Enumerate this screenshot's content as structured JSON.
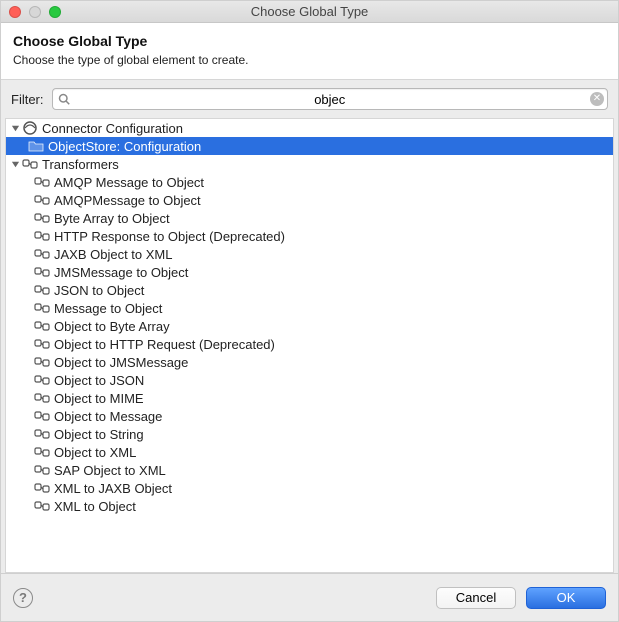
{
  "window": {
    "title": "Choose Global Type"
  },
  "header": {
    "heading": "Choose Global Type",
    "subtext": "Choose the type of global element to create."
  },
  "filter": {
    "label": "Filter:",
    "value": "objec",
    "placeholder": ""
  },
  "tree": {
    "groups": [
      {
        "name": "connector-config",
        "label": "Connector Configuration",
        "expanded": true,
        "iconKind": "connector",
        "children": [
          {
            "name": "objectstore-config",
            "label": "ObjectStore: Configuration",
            "selected": true,
            "iconKind": "folder"
          }
        ]
      },
      {
        "name": "transformers",
        "label": "Transformers",
        "expanded": true,
        "iconKind": "transformer",
        "children": [
          {
            "name": "amqp-message-to-object",
            "label": "AMQP Message to Object",
            "iconKind": "transformer"
          },
          {
            "name": "amqpmessage-to-object",
            "label": "AMQPMessage to Object",
            "iconKind": "transformer"
          },
          {
            "name": "byte-array-to-object",
            "label": "Byte Array to Object",
            "iconKind": "transformer"
          },
          {
            "name": "http-response-to-object",
            "label": "HTTP Response to Object (Deprecated)",
            "iconKind": "transformer"
          },
          {
            "name": "jaxb-object-to-xml",
            "label": "JAXB Object to XML",
            "iconKind": "transformer"
          },
          {
            "name": "jmsmessage-to-object",
            "label": "JMSMessage to Object",
            "iconKind": "transformer"
          },
          {
            "name": "json-to-object",
            "label": "JSON to Object",
            "iconKind": "transformer"
          },
          {
            "name": "message-to-object",
            "label": "Message to Object",
            "iconKind": "transformer"
          },
          {
            "name": "object-to-byte-array",
            "label": "Object to Byte Array",
            "iconKind": "transformer"
          },
          {
            "name": "object-to-http-request",
            "label": "Object to HTTP Request (Deprecated)",
            "iconKind": "transformer"
          },
          {
            "name": "object-to-jmsmessage",
            "label": "Object to JMSMessage",
            "iconKind": "transformer"
          },
          {
            "name": "object-to-json",
            "label": "Object to JSON",
            "iconKind": "transformer"
          },
          {
            "name": "object-to-mime",
            "label": "Object to MIME",
            "iconKind": "transformer"
          },
          {
            "name": "object-to-message",
            "label": "Object to Message",
            "iconKind": "transformer"
          },
          {
            "name": "object-to-string",
            "label": "Object to String",
            "iconKind": "transformer"
          },
          {
            "name": "object-to-xml",
            "label": "Object to XML",
            "iconKind": "transformer"
          },
          {
            "name": "sap-object-to-xml",
            "label": "SAP Object to XML",
            "iconKind": "transformer"
          },
          {
            "name": "xml-to-jaxb-object",
            "label": "XML to JAXB Object",
            "iconKind": "transformer"
          },
          {
            "name": "xml-to-object",
            "label": "XML to Object",
            "iconKind": "transformer"
          }
        ]
      }
    ]
  },
  "buttons": {
    "cancel": "Cancel",
    "ok": "OK"
  }
}
